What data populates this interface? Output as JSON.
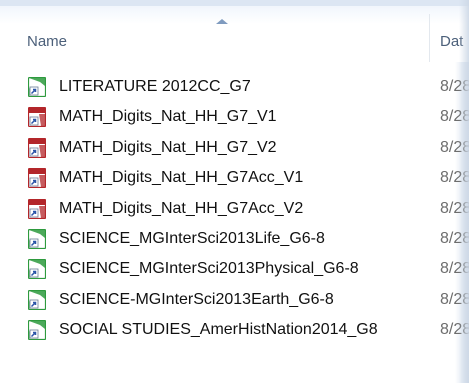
{
  "columns": {
    "name": "Name",
    "date": "Dat"
  },
  "colors": {
    "green_icon": "#2e9a3e",
    "red_icon": "#b3262a",
    "icon_inner": "#2b55a8"
  },
  "files": [
    {
      "name": "LITERATURE 2012CC_G7",
      "date": "8/28",
      "icon": "green-shortcut-icon"
    },
    {
      "name": "MATH_Digits_Nat_HH_G7_V1",
      "date": "8/28",
      "icon": "red-shortcut-icon"
    },
    {
      "name": "MATH_Digits_Nat_HH_G7_V2",
      "date": "8/28",
      "icon": "red-shortcut-icon"
    },
    {
      "name": "MATH_Digits_Nat_HH_G7Acc_V1",
      "date": "8/28",
      "icon": "red-shortcut-icon"
    },
    {
      "name": "MATH_Digits_Nat_HH_G7Acc_V2",
      "date": "8/28",
      "icon": "red-shortcut-icon"
    },
    {
      "name": "SCIENCE_MGInterSci2013Life_G6-8",
      "date": "8/28",
      "icon": "green-shortcut-icon"
    },
    {
      "name": "SCIENCE_MGInterSci2013Physical_G6-8",
      "date": "8/28",
      "icon": "green-shortcut-icon"
    },
    {
      "name": "SCIENCE-MGInterSci2013Earth_G6-8",
      "date": "8/28",
      "icon": "green-shortcut-icon"
    },
    {
      "name": "SOCIAL STUDIES_AmerHistNation2014_G8",
      "date": "8/28",
      "icon": "green-shortcut-icon"
    }
  ]
}
